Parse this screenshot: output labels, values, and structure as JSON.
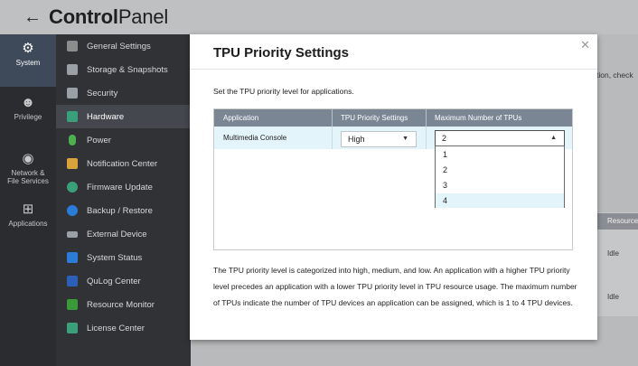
{
  "header": {
    "back_icon": "back-arrow-icon",
    "title_bold": "Control",
    "title_rest": "Panel"
  },
  "rail": [
    {
      "label": "System",
      "icon": "gear-icon",
      "active": true
    },
    {
      "label": "Privilege",
      "icon": "user-icon",
      "active": false
    },
    {
      "label": "Network &\nFile Services",
      "icon": "globe-icon",
      "active": false
    },
    {
      "label": "Applications",
      "icon": "apps-icon",
      "active": false
    }
  ],
  "menu": [
    {
      "label": "General Settings",
      "icon": "general-settings-icon",
      "color": "#8c8c8c"
    },
    {
      "label": "Storage & Snapshots",
      "icon": "storage-icon",
      "color": "#9aa0a6"
    },
    {
      "label": "Security",
      "icon": "security-icon",
      "color": "#9aa0a6"
    },
    {
      "label": "Hardware",
      "icon": "hardware-icon",
      "color": "#3aa07a",
      "active": true
    },
    {
      "label": "Power",
      "icon": "power-icon",
      "color": "#4caf50"
    },
    {
      "label": "Notification Center",
      "icon": "notification-icon",
      "color": "#d9a23a"
    },
    {
      "label": "Firmware Update",
      "icon": "firmware-icon",
      "color": "#3aa07a"
    },
    {
      "label": "Backup / Restore",
      "icon": "backup-icon",
      "color": "#2b7bd8"
    },
    {
      "label": "External Device",
      "icon": "external-device-icon",
      "color": "#9aa0a6"
    },
    {
      "label": "System Status",
      "icon": "system-status-icon",
      "color": "#2b7bd8"
    },
    {
      "label": "QuLog Center",
      "icon": "qulog-icon",
      "color": "#2b5fb8"
    },
    {
      "label": "Resource Monitor",
      "icon": "resource-monitor-icon",
      "color": "#3a9a3a"
    },
    {
      "label": "License Center",
      "icon": "license-icon",
      "color": "#3aa07a"
    }
  ],
  "background": {
    "strip_text": "tion, check",
    "table_header": "Resource",
    "cells": [
      "Idle",
      "Idle"
    ]
  },
  "dialog": {
    "title": "TPU Priority Settings",
    "close_icon": "close-icon",
    "description": "Set the TPU priority level for applications.",
    "columns": [
      "Application",
      "TPU Priority Settings",
      "Maximum Number of TPUs"
    ],
    "rows": [
      {
        "application": "Multimedia Console",
        "priority": "High",
        "max_tpus": "2"
      }
    ],
    "dropdown_options": [
      "1",
      "2",
      "3",
      "4"
    ],
    "dropdown_highlight": "4",
    "note": "The TPU priority level is categorized into high, medium, and low. An application with a higher TPU priority level precedes an application with a lower TPU priority level in TPU resource usage. The maximum number of TPUs indicate the number of TPU devices an application can be assigned, which is 1 to 4 TPU devices."
  }
}
